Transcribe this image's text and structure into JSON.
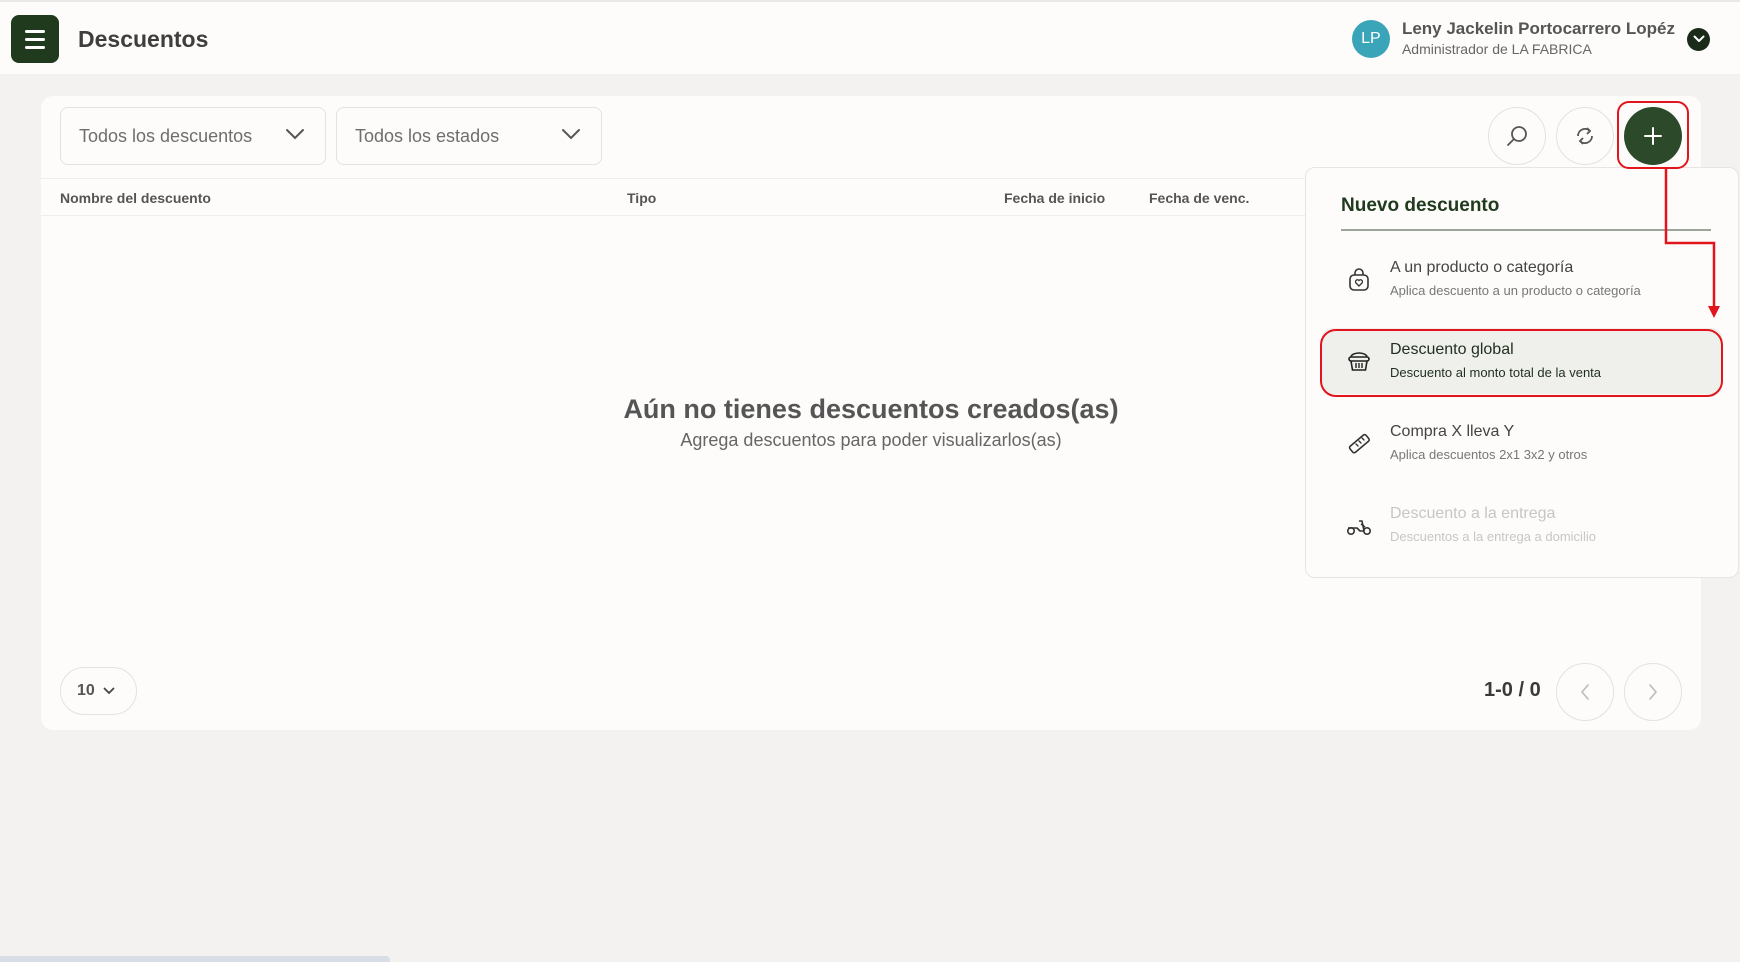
{
  "header": {
    "title": "Descuentos",
    "user": {
      "initials": "LP",
      "name": "Leny Jackelin Portocarrero Lopéz",
      "role": "Administrador de LA FABRICA"
    }
  },
  "filters": {
    "discount_type": "Todos los descuentos",
    "status": "Todos los estados"
  },
  "table": {
    "columns": [
      "Nombre del descuento",
      "Tipo",
      "Fecha de inicio",
      "Fecha de venc."
    ]
  },
  "empty_state": {
    "title": "Aún no tienes descuentos creados(as)",
    "subtitle": "Agrega descuentos para poder visualizarlos(as)"
  },
  "pagination": {
    "page_size": "10",
    "range": "1-0 / 0"
  },
  "new_discount_menu": {
    "title": "Nuevo descuento",
    "items": [
      {
        "label": "A un producto o categoría",
        "description": "Aplica descuento a un producto o categoría",
        "icon": "bag-icon",
        "enabled": true,
        "highlighted": false
      },
      {
        "label": "Descuento global",
        "description": "Descuento al monto total de la venta",
        "icon": "basket-icon",
        "enabled": true,
        "highlighted": true
      },
      {
        "label": "Compra X lleva Y",
        "description": "Aplica descuentos 2x1 3x2 y otros",
        "icon": "ruler-tag-icon",
        "enabled": true,
        "highlighted": false
      },
      {
        "label": "Descuento a la entrega",
        "description": "Descuentos a la entrega a domicilio",
        "icon": "scooter-icon",
        "enabled": false,
        "highlighted": false
      }
    ]
  },
  "colors": {
    "brand_dark_green": "#1f3a1d",
    "add_button": "#2c4a2a",
    "avatar": "#3aa5b8",
    "annotation_red": "#e2141c"
  }
}
